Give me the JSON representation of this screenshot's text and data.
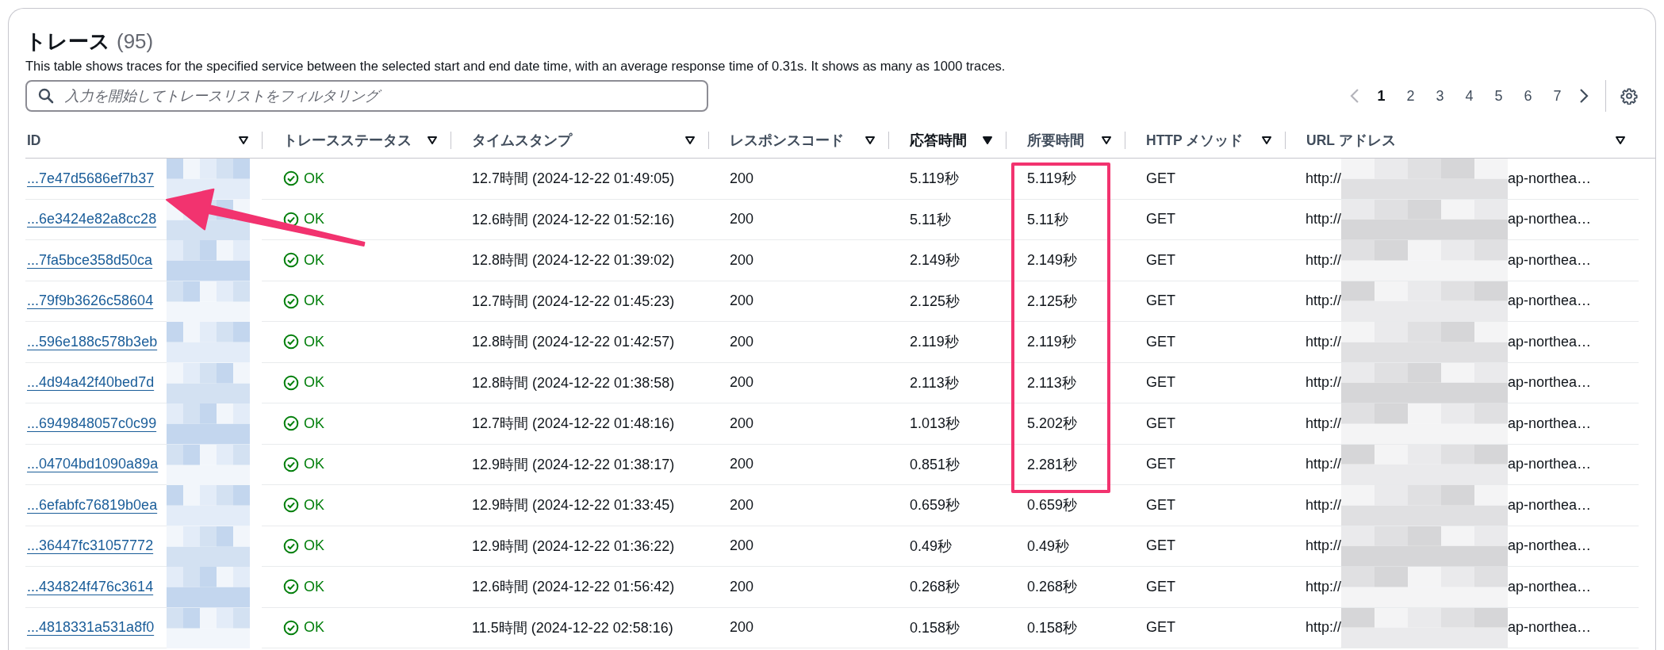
{
  "header": {
    "title": "トレース",
    "count": "(95)",
    "description": "This table shows traces for the specified service between the selected start and end date time, with an average response time of 0.31s. It shows as many as 1000 traces."
  },
  "search": {
    "placeholder": "入力を開始してトレースリストをフィルタリング"
  },
  "pagination": {
    "previous_disabled": true,
    "next_disabled": false,
    "pages": [
      {
        "label": "1",
        "selected": true
      },
      {
        "label": "2",
        "selected": false
      },
      {
        "label": "3",
        "selected": false
      },
      {
        "label": "4",
        "selected": false
      },
      {
        "label": "5",
        "selected": false
      },
      {
        "label": "6",
        "selected": false
      },
      {
        "label": "7",
        "selected": false
      }
    ]
  },
  "table": {
    "columns": [
      {
        "label": "ID",
        "sorted": false
      },
      {
        "label": "トレースステータス",
        "sorted": false
      },
      {
        "label": "タイムスタンプ",
        "sorted": false
      },
      {
        "label": "レスポンスコード",
        "sorted": false
      },
      {
        "label": "応答時間",
        "sorted": true
      },
      {
        "label": "所要時間",
        "sorted": false
      },
      {
        "label": "HTTP メソッド",
        "sorted": false
      },
      {
        "label": "URL アドレス",
        "sorted": false
      }
    ],
    "rows": [
      {
        "id": "...7e47d5686ef7b37",
        "status": "OK",
        "timestamp": "12.7時間 (2024-12-22 01:49:05)",
        "response_code": "200",
        "response_time": "5.119秒",
        "duration": "5.119秒",
        "method": "GET",
        "url_start": "http://",
        "url_end": "ap-northea…"
      },
      {
        "id": "...6e3424e82a8cc28",
        "status": "OK",
        "timestamp": "12.6時間 (2024-12-22 01:52:16)",
        "response_code": "200",
        "response_time": "5.11秒",
        "duration": "5.11秒",
        "method": "GET",
        "url_start": "http://",
        "url_end": "ap-northea…"
      },
      {
        "id": "...7fa5bce358d50ca",
        "status": "OK",
        "timestamp": "12.8時間 (2024-12-22 01:39:02)",
        "response_code": "200",
        "response_time": "2.149秒",
        "duration": "2.149秒",
        "method": "GET",
        "url_start": "http://",
        "url_end": "ap-northea…"
      },
      {
        "id": "...79f9b3626c58604",
        "status": "OK",
        "timestamp": "12.7時間 (2024-12-22 01:45:23)",
        "response_code": "200",
        "response_time": "2.125秒",
        "duration": "2.125秒",
        "method": "GET",
        "url_start": "http://",
        "url_end": "ap-northea…"
      },
      {
        "id": "...596e188c578b3eb",
        "status": "OK",
        "timestamp": "12.8時間 (2024-12-22 01:42:57)",
        "response_code": "200",
        "response_time": "2.119秒",
        "duration": "2.119秒",
        "method": "GET",
        "url_start": "http://",
        "url_end": "ap-northea…"
      },
      {
        "id": "...4d94a42f40bed7d",
        "status": "OK",
        "timestamp": "12.8時間 (2024-12-22 01:38:58)",
        "response_code": "200",
        "response_time": "2.113秒",
        "duration": "2.113秒",
        "method": "GET",
        "url_start": "http://",
        "url_end": "ap-northea…"
      },
      {
        "id": "...6949848057c0c99",
        "status": "OK",
        "timestamp": "12.7時間 (2024-12-22 01:48:16)",
        "response_code": "200",
        "response_time": "1.013秒",
        "duration": "5.202秒",
        "method": "GET",
        "url_start": "http://",
        "url_end": "ap-northea…"
      },
      {
        "id": "...04704bd1090a89a",
        "status": "OK",
        "timestamp": "12.9時間 (2024-12-22 01:38:17)",
        "response_code": "200",
        "response_time": "0.851秒",
        "duration": "2.281秒",
        "method": "GET",
        "url_start": "http://",
        "url_end": "ap-northea…"
      },
      {
        "id": "...6efabfc76819b0ea",
        "status": "OK",
        "timestamp": "12.9時間 (2024-12-22 01:33:45)",
        "response_code": "200",
        "response_time": "0.659秒",
        "duration": "0.659秒",
        "method": "GET",
        "url_start": "http://",
        "url_end": "ap-northea…"
      },
      {
        "id": "...36447fc31057772",
        "status": "OK",
        "timestamp": "12.9時間 (2024-12-22 01:36:22)",
        "response_code": "200",
        "response_time": "0.49秒",
        "duration": "0.49秒",
        "method": "GET",
        "url_start": "http://",
        "url_end": "ap-northea…"
      },
      {
        "id": "...434824f476c3614",
        "status": "OK",
        "timestamp": "12.6時間 (2024-12-22 01:56:42)",
        "response_code": "200",
        "response_time": "0.268秒",
        "duration": "0.268秒",
        "method": "GET",
        "url_start": "http://",
        "url_end": "ap-northea…"
      },
      {
        "id": "...4818331a531a8f0",
        "status": "OK",
        "timestamp": "11.5時間 (2024-12-22 02:58:16)",
        "response_code": "200",
        "response_time": "0.158秒",
        "duration": "0.158秒",
        "method": "GET",
        "url_start": "http://",
        "url_end": "ap-northea…"
      }
    ]
  },
  "annotations": {
    "arrow": true,
    "highlight_box": true
  }
}
